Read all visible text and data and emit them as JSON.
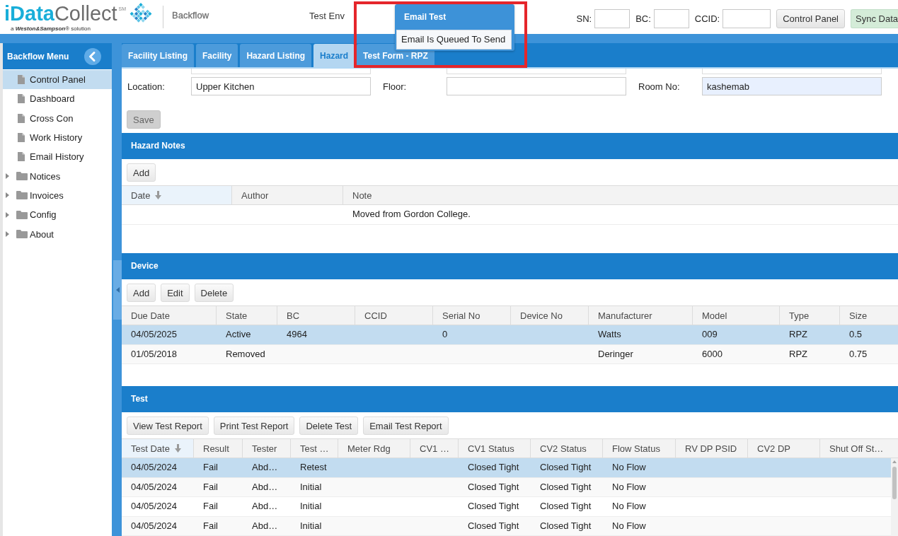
{
  "header": {
    "logo": {
      "name_part_1": "iData",
      "name_part_2": "Collect",
      "service_mark": "SM",
      "tagline": "a **Weston&Sampson**® solution"
    },
    "app_name": "Backflow",
    "environment": "Test Env",
    "lookup_fields": [
      {
        "label": "SN:"
      },
      {
        "label": "BC:"
      },
      {
        "label": "CCID:"
      }
    ],
    "buttons": [
      {
        "label": "Control Panel",
        "kind": "default"
      },
      {
        "label": "Sync Data",
        "kind": "success"
      }
    ]
  },
  "notification": {
    "title": "Email Test",
    "message": "Email Is Queued To Send"
  },
  "sidebar": {
    "title": "Backflow Menu",
    "pages": [
      {
        "label": "Control Panel",
        "selected": true
      },
      {
        "label": "Dashboard",
        "selected": false
      },
      {
        "label": "Cross Con",
        "selected": false
      },
      {
        "label": "Work History",
        "selected": false
      },
      {
        "label": "Email History",
        "selected": false
      }
    ],
    "folders": [
      {
        "label": "Notices",
        "selected": false,
        "expanded": false
      },
      {
        "label": "Invoices",
        "selected": false,
        "expanded": false
      },
      {
        "label": "Config",
        "selected": false,
        "expanded": false
      },
      {
        "label": "About",
        "selected": false,
        "expanded": false
      }
    ]
  },
  "tabs": [
    {
      "label": "Facility Listing",
      "selected": false
    },
    {
      "label": "Facility",
      "selected": false
    },
    {
      "label": "Hazard Listing",
      "selected": false
    },
    {
      "label": "Hazard",
      "selected": true
    },
    {
      "label": "Test Form - RPZ",
      "selected": false
    }
  ],
  "form": {
    "clipped_fields": [
      {
        "kind": "input"
      },
      {
        "kind": "input"
      },
      {
        "kind": "input"
      }
    ],
    "fields": [
      {
        "label": "Location:",
        "value": "Upper Kitchen",
        "autofilled": false
      },
      {
        "label": "Floor:",
        "autofilled": false
      },
      {
        "label": "Room No:",
        "value": "kashemab",
        "autofilled": true
      }
    ],
    "save_button": {
      "label": "Save",
      "disabled": true
    }
  },
  "sections": [
    {
      "title": "Hazard Notes",
      "buttons": [
        "Add"
      ],
      "table": {
        "columns": [
          {
            "label": "Date",
            "sorted": true
          },
          {
            "label": "Author",
            "sorted": false
          },
          {
            "label": "Note",
            "sorted": false
          }
        ],
        "rows": [
          {
            "selected": false,
            "cells": [
              null,
              null,
              "Moved from Gordon College."
            ]
          }
        ]
      }
    },
    {
      "title": "Device",
      "buttons": [
        "Add",
        "Edit",
        "Delete"
      ],
      "table": {
        "columns": [
          {
            "label": "Due Date",
            "sorted": false
          },
          {
            "label": "State",
            "sorted": false
          },
          {
            "label": "BC",
            "sorted": false
          },
          {
            "label": "CCID",
            "sorted": false
          },
          {
            "label": "Serial No",
            "sorted": false
          },
          {
            "label": "Device No",
            "sorted": false
          },
          {
            "label": "Manufacturer",
            "sorted": false
          },
          {
            "label": "Model",
            "sorted": false
          },
          {
            "label": "Type",
            "sorted": false
          },
          {
            "label": "Size",
            "sorted": false
          }
        ],
        "rows": [
          {
            "selected": true,
            "cells": [
              "04/05/2025",
              "Active",
              "4964",
              null,
              "0",
              null,
              "Watts",
              "009",
              "RPZ",
              "0.5"
            ]
          },
          {
            "selected": false,
            "cells": [
              "01/05/2018",
              "Removed",
              null,
              null,
              null,
              null,
              "Deringer",
              "6000",
              "RPZ",
              "0.75"
            ]
          }
        ]
      }
    },
    {
      "title": "Test",
      "buttons": [
        "View Test Report",
        "Print Test Report",
        "Delete Test",
        "Email Test Report"
      ],
      "table": {
        "scrollable": true,
        "columns": [
          {
            "label": "Test Date",
            "sorted": true
          },
          {
            "label": "Result",
            "sorted": false
          },
          {
            "label": "Tester",
            "sorted": false
          },
          {
            "label": "Test …",
            "sorted": false
          },
          {
            "label": "Meter Rdg",
            "sorted": false
          },
          {
            "label": "CV1 …",
            "sorted": false
          },
          {
            "label": "CV1 Status",
            "sorted": false
          },
          {
            "label": "CV2 Status",
            "sorted": false
          },
          {
            "label": "Flow Status",
            "sorted": false
          },
          {
            "label": "RV DP PSID",
            "sorted": false
          },
          {
            "label": "CV2 DP",
            "sorted": false
          },
          {
            "label": "Shut Off St…",
            "sorted": false
          }
        ],
        "rows": [
          {
            "selected": true,
            "cells": [
              "04/05/2024",
              "Fail",
              "Abd…",
              "Retest",
              null,
              null,
              "Closed Tight",
              "Closed Tight",
              "No Flow",
              null,
              null,
              null
            ]
          },
          {
            "selected": false,
            "cells": [
              "04/05/2024",
              "Fail",
              "Abd…",
              "Initial",
              null,
              null,
              "Closed Tight",
              "Closed Tight",
              "No Flow",
              null,
              null,
              null
            ]
          },
          {
            "selected": false,
            "cells": [
              "04/05/2024",
              "Fail",
              "Abd…",
              "Initial",
              null,
              null,
              "Closed Tight",
              "Closed Tight",
              "No Flow",
              null,
              null,
              null
            ]
          },
          {
            "selected": false,
            "cells": [
              "04/05/2024",
              "Fail",
              "Abd…",
              "Initial",
              null,
              null,
              "Closed Tight",
              "Closed Tight",
              "No Flow",
              null,
              null,
              null
            ]
          }
        ]
      }
    }
  ]
}
